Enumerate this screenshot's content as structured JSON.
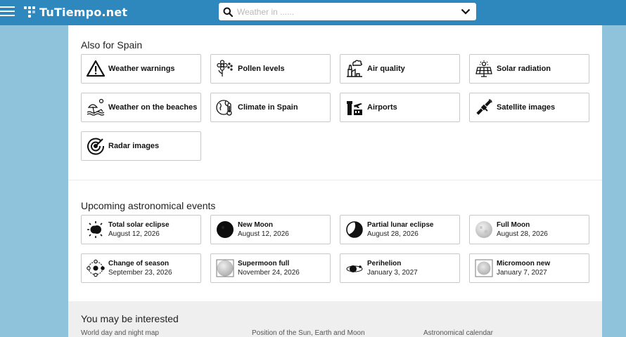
{
  "header": {
    "logo_text": "TuTiempo.net",
    "search_placeholder": "Weather in ......",
    "bg_color": "#2f88bd"
  },
  "also": {
    "title": "Also for Spain",
    "items": [
      {
        "label": "Weather warnings",
        "icon": "warning-icon"
      },
      {
        "label": "Pollen levels",
        "icon": "pollen-icon"
      },
      {
        "label": "Air quality",
        "icon": "factory-icon"
      },
      {
        "label": "Solar radiation",
        "icon": "solar-panel-icon"
      },
      {
        "label": "Weather on the beaches",
        "icon": "beach-umbrella-icon"
      },
      {
        "label": "Climate in Spain",
        "icon": "globe-thermometer-icon"
      },
      {
        "label": "Airports",
        "icon": "airport-icon"
      },
      {
        "label": "Satellite images",
        "icon": "satellite-icon"
      },
      {
        "label": "Radar images",
        "icon": "radar-icon"
      }
    ]
  },
  "events": {
    "title": "Upcoming astronomical events",
    "items": [
      {
        "title": "Total solar eclipse",
        "date": "August 12, 2026",
        "icon": "solar-eclipse-icon"
      },
      {
        "title": "New Moon",
        "date": "August 12, 2026",
        "icon": "new-moon-icon"
      },
      {
        "title": "Partial lunar eclipse",
        "date": "August 28, 2026",
        "icon": "lunar-eclipse-icon"
      },
      {
        "title": "Full Moon",
        "date": "August 28, 2026",
        "icon": "full-moon-icon"
      },
      {
        "title": "Change of season",
        "date": "September 23, 2026",
        "icon": "season-orbit-icon"
      },
      {
        "title": "Supermoon full",
        "date": "November 24, 2026",
        "icon": "supermoon-icon"
      },
      {
        "title": "Perihelion",
        "date": "January 3, 2027",
        "icon": "perihelion-icon"
      },
      {
        "title": "Micromoon new",
        "date": "January 7, 2027",
        "icon": "micromoon-icon"
      }
    ]
  },
  "interest": {
    "title": "You may be interested",
    "links": [
      "World day and night map",
      "Position of the Sun, Earth and Moon",
      "Astronomical calendar"
    ]
  }
}
